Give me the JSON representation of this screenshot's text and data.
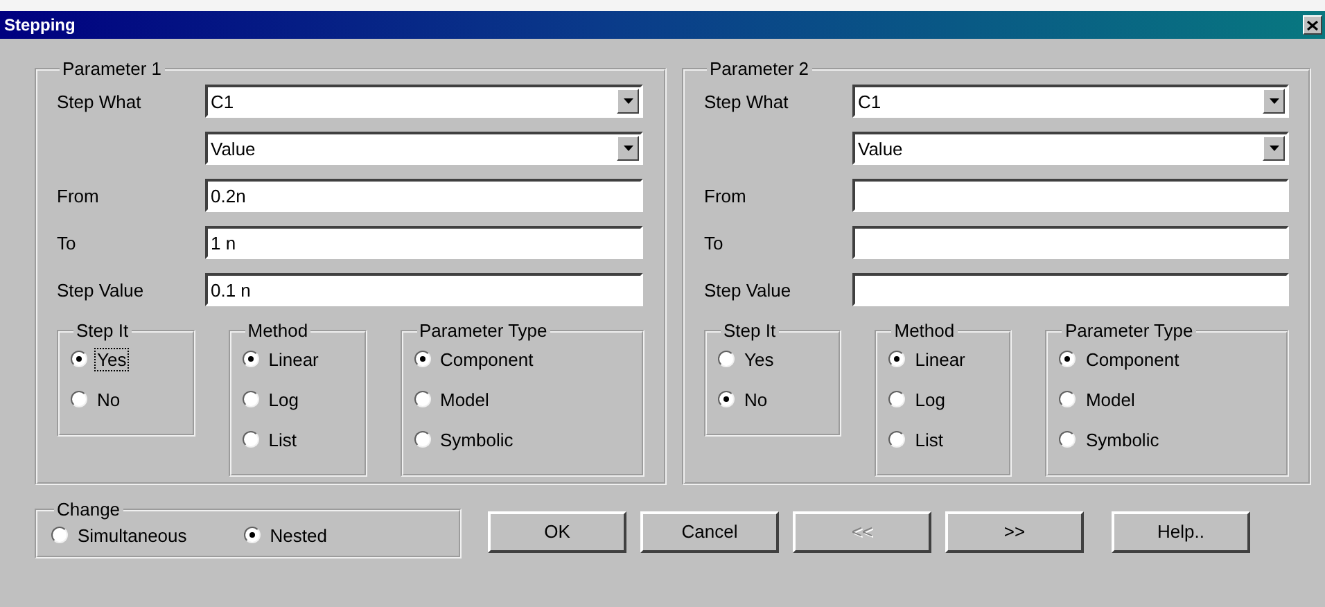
{
  "window": {
    "title": "Stepping"
  },
  "parameters": [
    {
      "title": "Parameter 1",
      "step_what": {
        "label": "Step What",
        "value": "C1"
      },
      "property": {
        "value": "Value"
      },
      "fields": [
        {
          "label": "From",
          "value": "0.2n"
        },
        {
          "label": "To",
          "value": "1 n"
        },
        {
          "label": "Step Value",
          "value": "0.1 n"
        }
      ],
      "groups": [
        {
          "title": "Step It",
          "options": [
            {
              "label": "Yes",
              "selected": true,
              "focused": true
            },
            {
              "label": "No",
              "selected": false,
              "focused": false
            }
          ]
        },
        {
          "title": "Method",
          "options": [
            {
              "label": "Linear",
              "selected": true,
              "focused": false
            },
            {
              "label": "Log",
              "selected": false,
              "focused": false
            },
            {
              "label": "List",
              "selected": false,
              "focused": false
            }
          ]
        },
        {
          "title": "Parameter Type",
          "options": [
            {
              "label": "Component",
              "selected": true,
              "focused": false
            },
            {
              "label": "Model",
              "selected": false,
              "focused": false
            },
            {
              "label": "Symbolic",
              "selected": false,
              "focused": false
            }
          ]
        }
      ]
    },
    {
      "title": "Parameter 2",
      "step_what": {
        "label": "Step What",
        "value": "C1"
      },
      "property": {
        "value": "Value"
      },
      "fields": [
        {
          "label": "From"
        },
        {
          "label": "To"
        },
        {
          "label": "Step Value"
        }
      ],
      "groups": [
        {
          "title": "Step It",
          "options": [
            {
              "label": "Yes",
              "selected": false,
              "focused": false
            },
            {
              "label": "No",
              "selected": true,
              "focused": false
            }
          ]
        },
        {
          "title": "Method",
          "options": [
            {
              "label": "Linear",
              "selected": true,
              "focused": false
            },
            {
              "label": "Log",
              "selected": false,
              "focused": false
            },
            {
              "label": "List",
              "selected": false,
              "focused": false
            }
          ]
        },
        {
          "title": "Parameter Type",
          "options": [
            {
              "label": "Component",
              "selected": true,
              "focused": false
            },
            {
              "label": "Model",
              "selected": false,
              "focused": false
            },
            {
              "label": "Symbolic",
              "selected": false,
              "focused": false
            }
          ]
        }
      ]
    }
  ],
  "change": {
    "title": "Change",
    "options": [
      {
        "label": "Simultaneous",
        "selected": false,
        "focused": false
      },
      {
        "label": "Nested",
        "selected": true,
        "focused": false
      }
    ]
  },
  "buttons": [
    {
      "label": "OK",
      "disabled": false
    },
    {
      "label": "Cancel",
      "disabled": false
    },
    {
      "label": "<<",
      "disabled": true
    },
    {
      "label": ">>",
      "disabled": false
    },
    {
      "label": "Help..",
      "disabled": false
    }
  ]
}
